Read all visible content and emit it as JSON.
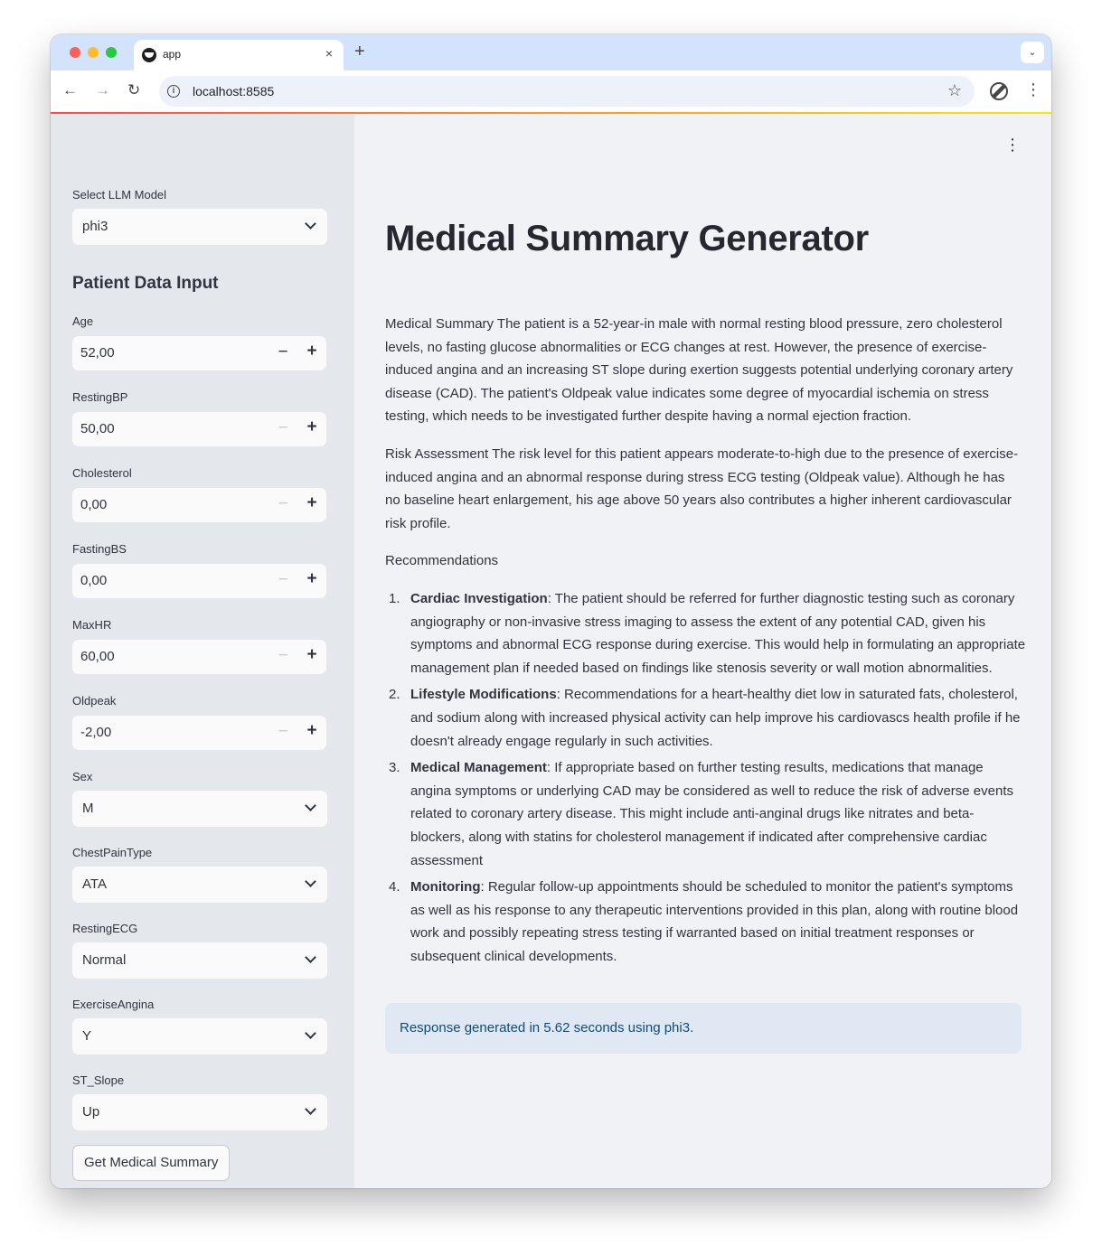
{
  "browser": {
    "tab_title": "app",
    "tab_close": "×",
    "new_tab": "+",
    "tab_search": "⌄",
    "url": "localhost:8585",
    "back": "←",
    "forward": "→",
    "reload": "↻",
    "info": "i",
    "star": "☆",
    "menu": "⋮"
  },
  "sidebar": {
    "model_label": "Select LLM Model",
    "model_value": "phi3",
    "section_title": "Patient Data Input",
    "numbers": [
      {
        "label": "Age",
        "value": "52,00",
        "minus": "−",
        "plus": "+"
      },
      {
        "label": "RestingBP",
        "value": "50,00",
        "minus": "−",
        "plus": "+"
      },
      {
        "label": "Cholesterol",
        "value": "0,00",
        "minus": "−",
        "plus": "+"
      },
      {
        "label": "FastingBS",
        "value": "0,00",
        "minus": "−",
        "plus": "+"
      },
      {
        "label": "MaxHR",
        "value": "60,00",
        "minus": "−",
        "plus": "+"
      },
      {
        "label": "Oldpeak",
        "value": "-2,00",
        "minus": "−",
        "plus": "+"
      }
    ],
    "selects": [
      {
        "label": "Sex",
        "value": "M"
      },
      {
        "label": "ChestPainType",
        "value": "ATA"
      },
      {
        "label": "RestingECG",
        "value": "Normal"
      },
      {
        "label": "ExerciseAngina",
        "value": "Y"
      },
      {
        "label": "ST_Slope",
        "value": "Up"
      }
    ],
    "button": "Get Medical Summary"
  },
  "main": {
    "menu": "⋮",
    "title": "Medical Summary Generator",
    "summary": "Medical Summary The patient is a 52-year-in male with normal resting blood pressure, zero cholesterol levels, no fasting glucose abnormalities or ECG changes at rest. However, the presence of exercise-induced angina and an increasing ST slope during exertion suggests potential underlying coronary artery disease (CAD). The patient's Oldpeak value indicates some degree of myocardial ischemia on stress testing, which needs to be investigated further despite having a normal ejection fraction.",
    "risk": "Risk Assessment The risk level for this patient appears moderate-to-high due to the presence of exercise-induced angina and an abnormal response during stress ECG testing (Oldpeak value). Although he has no baseline heart enlargement, his age above 50 years also contributes a higher inherent cardiovascular risk profile.",
    "recommendations_heading": "Recommendations",
    "recommendations": [
      {
        "num": "1.",
        "title": "Cardiac Investigation",
        "text": ": The patient should be referred for further diagnostic testing such as coronary angiography or non-invasive stress imaging to assess the extent of any potential CAD, given his symptoms and abnormal ECG response during exercise. This would help in formulating an appropriate management plan if needed based on findings like stenosis severity or wall motion abnormalities."
      },
      {
        "num": "2.",
        "title": "Lifestyle Modifications",
        "text": ": Recommendations for a heart-healthy diet low in saturated fats, cholesterol, and sodium along with increased physical activity can help improve his cardiovascs health profile if he doesn't already engage regularly in such activities."
      },
      {
        "num": "3.",
        "title": "Medical Management",
        "text": ": If appropriate based on further testing results, medications that manage angina symptoms or underlying CAD may be considered as well to reduce the risk of adverse events related to coronary artery disease. This might include anti-anginal drugs like nitrates and beta-blockers, along with statins for cholesterol management if indicated after comprehensive cardiac assessment"
      },
      {
        "num": "4.",
        "title": "Monitoring",
        "text": ": Regular follow-up appointments should be scheduled to monitor the patient's symptoms as well as his response to any therapeutic interventions provided in this plan, along with routine blood work and possibly repeating stress testing if warranted based on initial treatment responses or subsequent clinical developments."
      }
    ],
    "info": "Response generated in 5.62 seconds using phi3."
  }
}
